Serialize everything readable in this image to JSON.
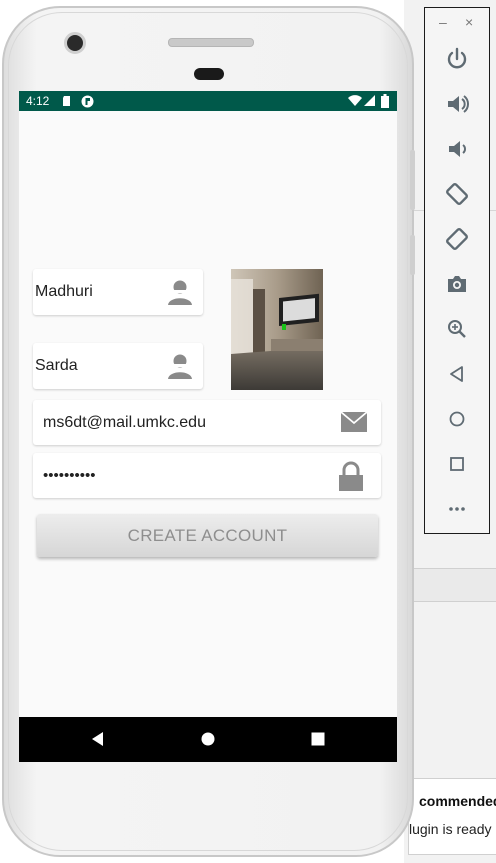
{
  "status_bar": {
    "time": "4:12"
  },
  "form": {
    "first_name": "Madhuri",
    "last_name": "Sarda",
    "email": "ms6dt@mail.umkc.edu",
    "password_masked": "••••••••••",
    "create_button_label": "CREATE ACCOUNT"
  },
  "emulator_toolbar": {
    "minimize": "–",
    "close": "×"
  },
  "ide": {
    "notification_title": "commended",
    "notification_body": "lugin is ready"
  },
  "colors": {
    "status_bar": "#00594a",
    "icon_gray": "#8a8a8a",
    "toolbar_icon": "#5f6b73"
  },
  "icons": [
    "power-icon",
    "volume-up-icon",
    "volume-down-icon",
    "rotate-left-icon",
    "rotate-right-icon",
    "camera-icon",
    "zoom-icon",
    "back-icon",
    "home-icon",
    "overview-icon",
    "more-icon",
    "person-icon",
    "mail-icon",
    "lock-icon"
  ]
}
